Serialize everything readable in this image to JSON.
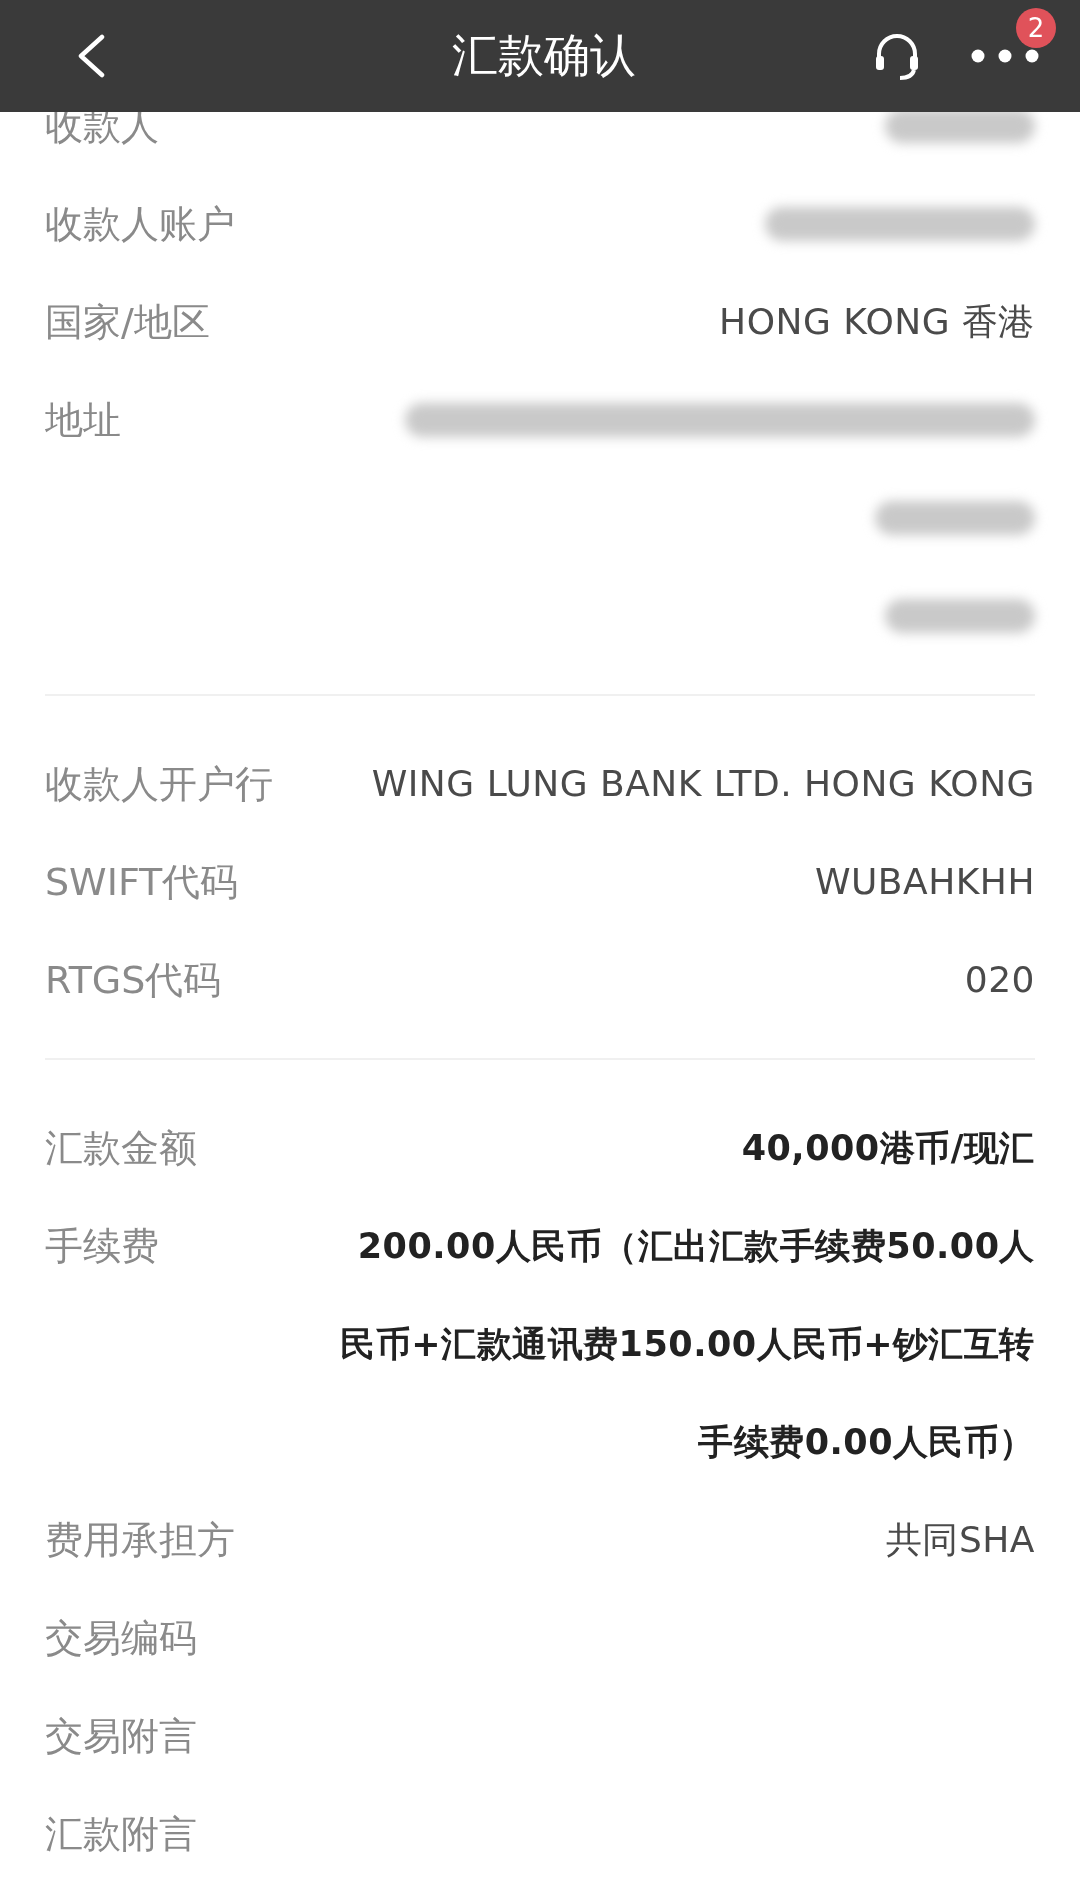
{
  "header": {
    "title": "汇款确认",
    "badge": "2"
  },
  "sections": [
    {
      "rows": [
        {
          "label": "收款人",
          "value": {
            "kind": "blurred"
          }
        },
        {
          "label": "收款人账户",
          "value": {
            "kind": "blurred"
          }
        },
        {
          "label": "国家/地区",
          "value": {
            "kind": "text",
            "text": "HONG KONG 香港"
          }
        },
        {
          "label": "地址",
          "value": {
            "kind": "blurred"
          }
        },
        {
          "value": {
            "kind": "blurred"
          }
        },
        {
          "value": {
            "kind": "blurred"
          }
        }
      ]
    },
    {
      "rows": [
        {
          "label": "收款人开户行",
          "value": {
            "kind": "text",
            "text": "WING LUNG BANK LTD. HONG KONG"
          }
        },
        {
          "label": "SWIFT代码",
          "value": {
            "kind": "text",
            "text": "WUBAHKHH"
          }
        },
        {
          "label": "RTGS代码",
          "value": {
            "kind": "text",
            "text": "020"
          }
        }
      ]
    },
    {
      "rows": [
        {
          "label": "汇款金额",
          "value": {
            "kind": "emphasis",
            "text": "40,000港币/现汇"
          }
        },
        {
          "label": "手续费",
          "value": {
            "kind": "emphasis",
            "text": "200.00人民币（汇出汇款手续费50.00人民币+汇款通讯费150.00人民币+钞汇互转手续费0.00人民币）"
          }
        },
        {
          "label": "费用承担方",
          "value": {
            "kind": "text",
            "text": "共同SHA"
          }
        },
        {
          "label": "交易编码"
        },
        {
          "label": "交易附言"
        },
        {
          "label": "汇款附言"
        }
      ]
    }
  ]
}
